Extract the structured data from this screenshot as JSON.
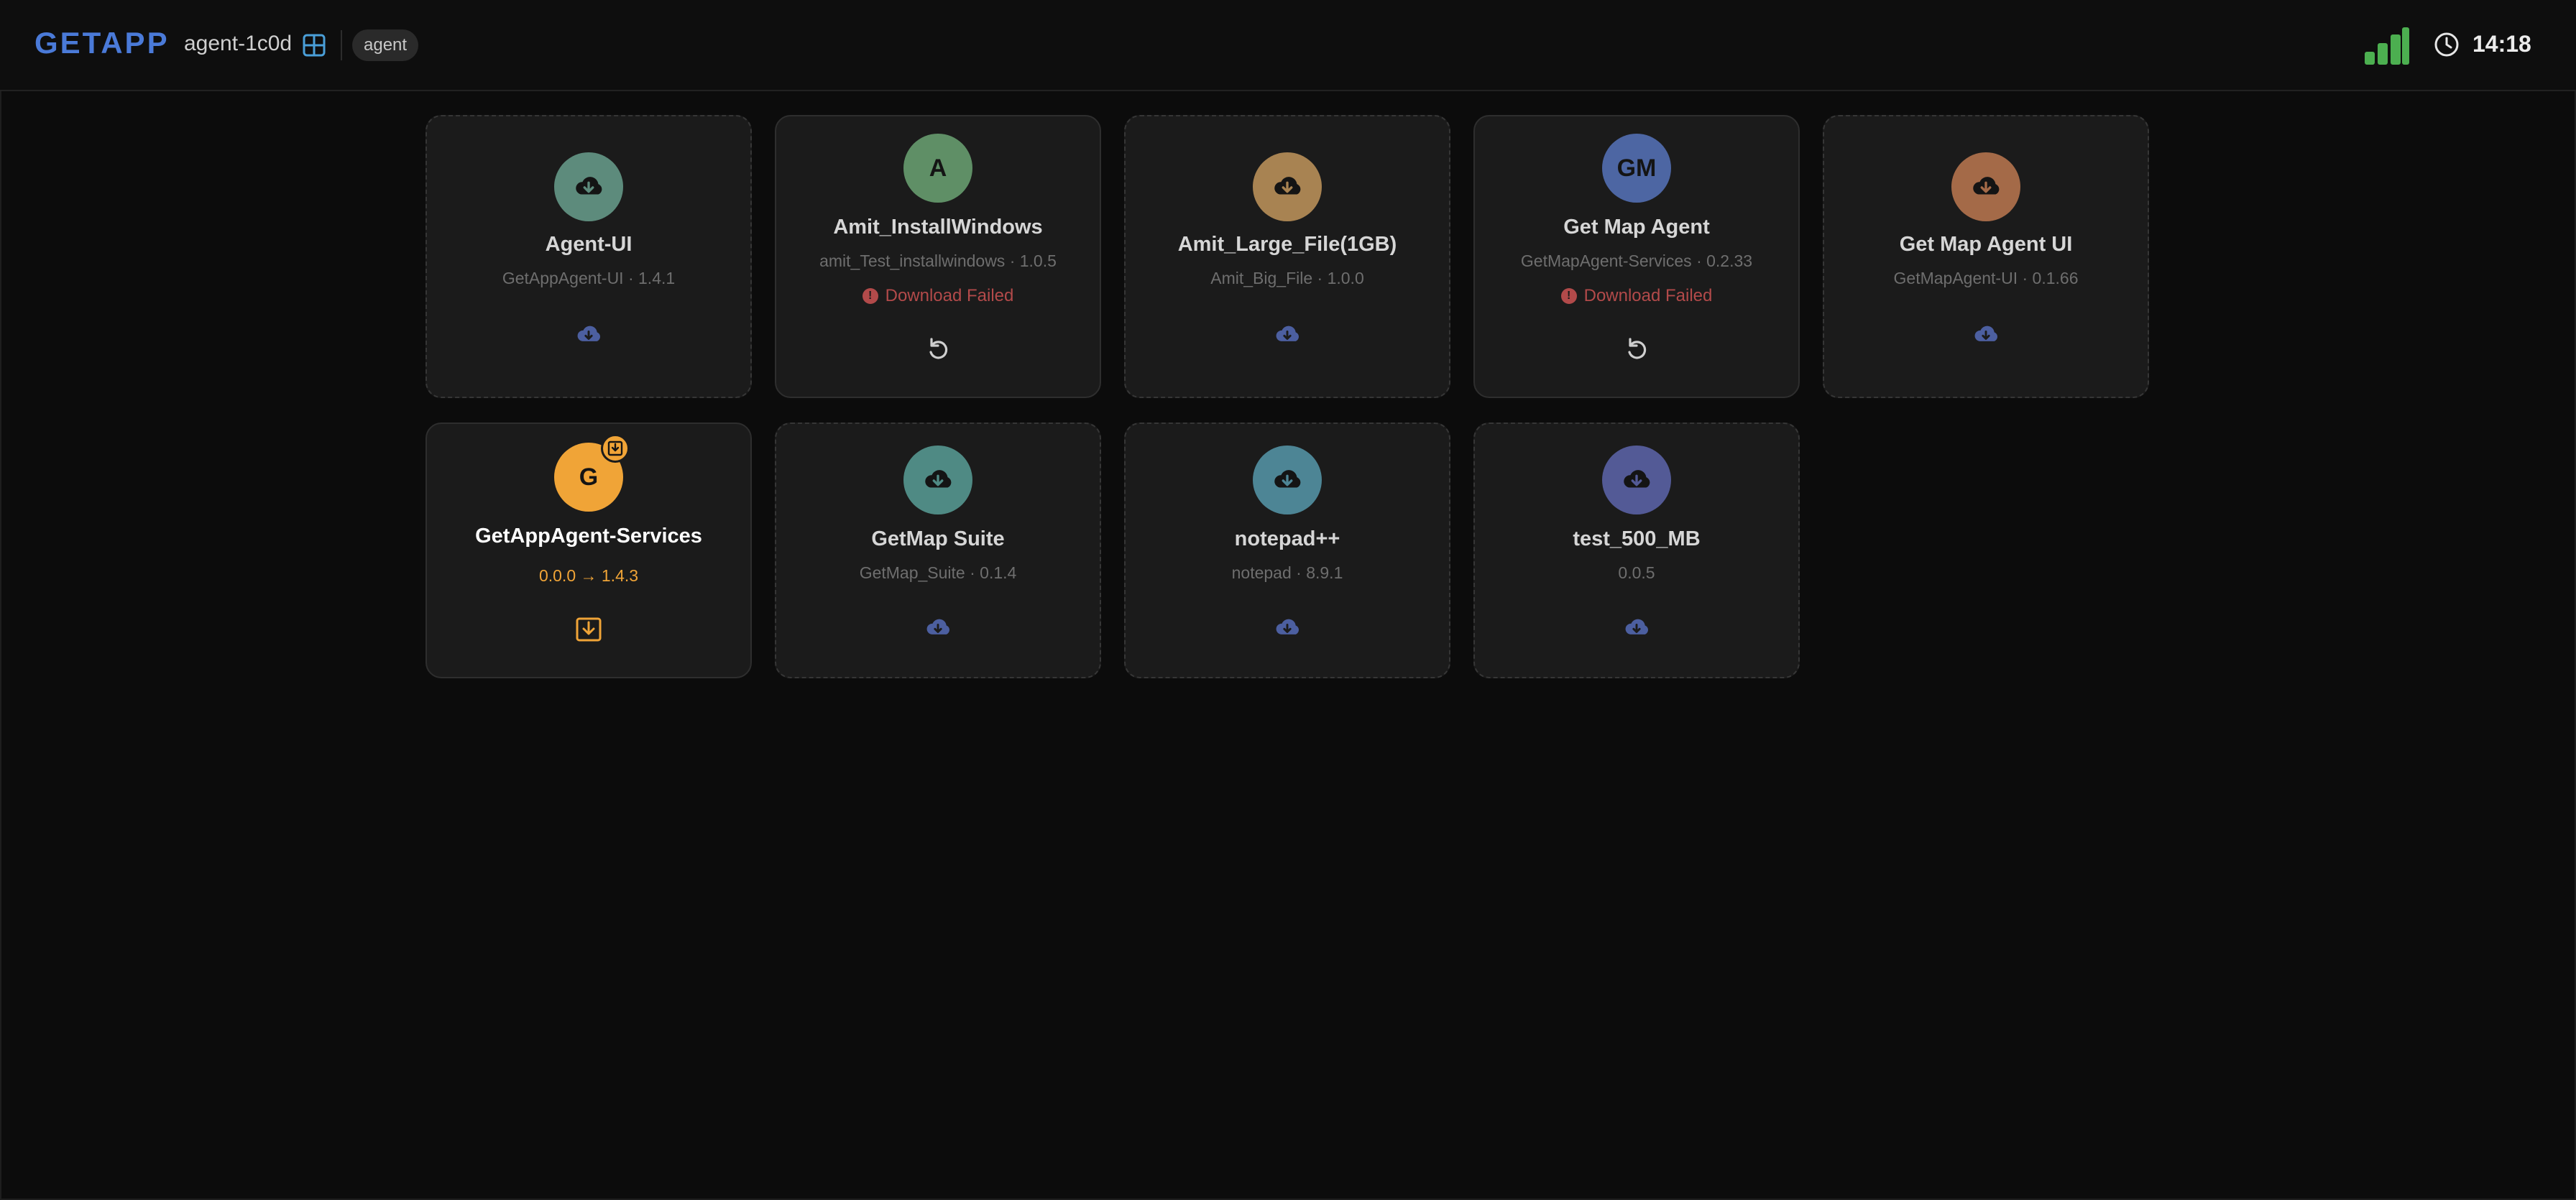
{
  "header": {
    "brand": "GETAPP",
    "agent_name": "agent-1c0d",
    "os_icon": "windows-icon",
    "role": "agent",
    "signal_icon": "signal-strength-icon",
    "time": "14:18"
  },
  "colors": {
    "brand": "#4a7ad8",
    "failed": "#b24a4a",
    "upgrade": "#f0a437",
    "download_action": "#4c5fa0",
    "signal": "#4caf50"
  },
  "cards": [
    {
      "title": "Agent-UI",
      "subtitle": "GetAppAgent-UI · 1.4.1",
      "avatar_text": "",
      "avatar_color": "#5d8b7c",
      "status": "",
      "action": "cloud-download-icon"
    },
    {
      "title": "Amit_InstallWindows",
      "subtitle": "amit_Test_installwindows · 1.0.5",
      "avatar_text": "A",
      "avatar_color": "#5f8f66",
      "status": "Download Failed",
      "action": "retry-icon"
    },
    {
      "title": "Amit_Large_File(1GB)",
      "subtitle": "Amit_Big_File · 1.0.0",
      "avatar_text": "",
      "avatar_color": "#a88352",
      "status": "",
      "action": "cloud-download-icon"
    },
    {
      "title": "Get Map Agent",
      "subtitle": "GetMapAgent-Services · 0.2.33",
      "avatar_text": "GM",
      "avatar_color": "#4d66a3",
      "status": "Download Failed",
      "action": "retry-icon"
    },
    {
      "title": "Get Map Agent UI",
      "subtitle": "GetMapAgent-UI · 0.1.66",
      "avatar_text": "",
      "avatar_color": "#a46a48",
      "status": "",
      "action": "cloud-download-icon"
    },
    {
      "title": "GetAppAgent-Services",
      "subtitle": "0.0.0 → 1.4.3",
      "avatar_text": "G",
      "avatar_color": "#f0a437",
      "status": "",
      "action": "install-update-icon"
    },
    {
      "title": "GetMap Suite",
      "subtitle": "GetMap_Suite · 0.1.4",
      "avatar_text": "",
      "avatar_color": "#4f8a84",
      "status": "",
      "action": "cloud-download-icon"
    },
    {
      "title": "notepad++",
      "subtitle": "notepad · 8.9.1",
      "avatar_text": "",
      "avatar_color": "#4d8595",
      "status": "",
      "action": "cloud-download-icon"
    },
    {
      "title": "test_500_MB",
      "subtitle": "0.0.5",
      "avatar_text": "",
      "avatar_color": "#535a96",
      "status": "",
      "action": "cloud-download-icon"
    }
  ]
}
